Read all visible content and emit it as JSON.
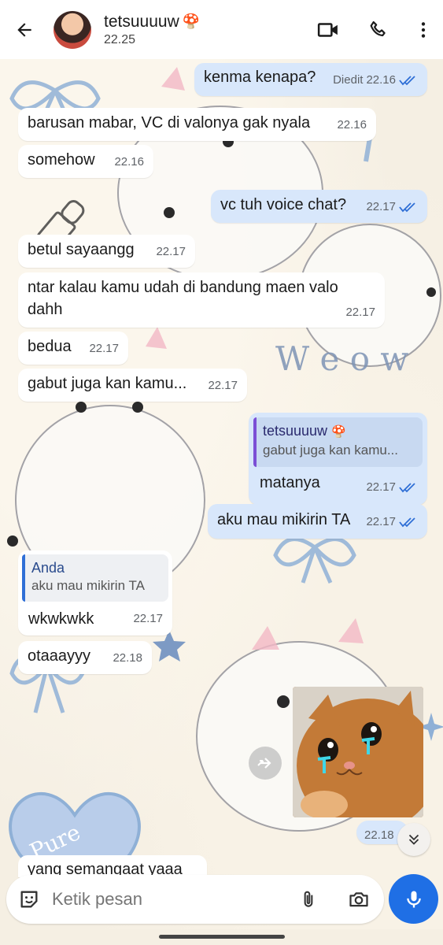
{
  "header": {
    "contact_name": "tetsuuuuw",
    "name_emoji": "🍄",
    "status": "22.25"
  },
  "messages": [
    {
      "dir": "out",
      "text": "kenma kenapa?",
      "edited": "Diedit",
      "time": "22.16",
      "read": true
    },
    {
      "dir": "in",
      "text": "barusan mabar, VC di valonya gak nyala",
      "time": "22.16"
    },
    {
      "dir": "in",
      "text": "somehow",
      "time": "22.16"
    },
    {
      "dir": "out",
      "text": "vc tuh voice chat?",
      "time": "22.17",
      "read": true
    },
    {
      "dir": "in",
      "text": "betul sayaangg",
      "time": "22.17"
    },
    {
      "dir": "in",
      "text_line1": "ntar kalau kamu udah di bandung maen valo",
      "text_line2": "dahh",
      "time": "22.17"
    },
    {
      "dir": "in",
      "text": "bedua",
      "time": "22.17"
    },
    {
      "dir": "in",
      "text": "gabut juga kan kamu...",
      "time": "22.17"
    },
    {
      "dir": "out",
      "quote_author": "tetsuuuuw",
      "quote_emoji": "🍄",
      "quote_text": "gabut juga kan kamu...",
      "text": "matanya",
      "time": "22.17",
      "read": true
    },
    {
      "dir": "out",
      "text": "aku mau mikirin TA",
      "time": "22.17",
      "read": true
    },
    {
      "dir": "in",
      "quote_author": "Anda",
      "quote_text": "aku mau mikirin TA",
      "text": "wkwkwkk",
      "time": "22.17"
    },
    {
      "dir": "in",
      "text": "otaaayyy",
      "time": "22.18"
    },
    {
      "dir": "out",
      "type": "image",
      "image_desc": "crying-cat-sticker",
      "time": "22.18"
    },
    {
      "dir": "in",
      "text": "yang semangaat yaaa",
      "partial": true
    }
  ],
  "input": {
    "placeholder": "Ketik pesan"
  },
  "colors": {
    "outgoing_bubble": "#d8e7fb",
    "incoming_bubble": "#ffffff",
    "accent": "#1f6fe5",
    "read_tick": "#2f6fd6"
  },
  "icons": [
    "back-arrow-icon",
    "video-call-icon",
    "phone-icon",
    "more-vert-icon",
    "sticker-icon",
    "attach-icon",
    "camera-icon",
    "mic-icon",
    "forward-icon",
    "scroll-down-icon"
  ]
}
